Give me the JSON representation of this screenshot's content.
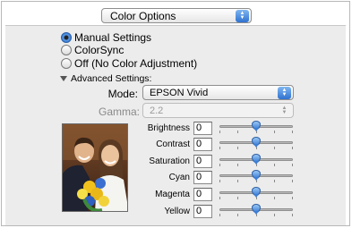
{
  "color_options": {
    "label": "Color Options"
  },
  "radios": [
    {
      "label": "Manual Settings",
      "selected": true
    },
    {
      "label": "ColorSync",
      "selected": false
    },
    {
      "label": "Off (No Color Adjustment)",
      "selected": false
    }
  ],
  "advanced": {
    "label": "Advanced Settings:",
    "mode_label": "Mode:",
    "mode_value": "EPSON Vivid",
    "gamma_label": "Gamma:",
    "gamma_value": "2.2"
  },
  "adjustments": [
    {
      "label": "Brightness",
      "value": "0",
      "level": 0.5
    },
    {
      "label": "Contrast",
      "value": "0",
      "level": 0.5
    },
    {
      "label": "Saturation",
      "value": "0",
      "level": 0.5
    },
    {
      "label": "Cyan",
      "value": "0",
      "level": 0.5
    },
    {
      "label": "Magenta",
      "value": "0",
      "level": 0.5
    },
    {
      "label": "Yellow",
      "value": "0",
      "level": 0.5
    }
  ],
  "icons": {
    "popup_arrows": "up-down-arrows-icon",
    "disclosure": "disclosure-triangle-icon",
    "preview": "preview-photo-couple-with-flowers"
  },
  "colors": {
    "accent": "#3d7fd6",
    "panel": "#ececec"
  }
}
